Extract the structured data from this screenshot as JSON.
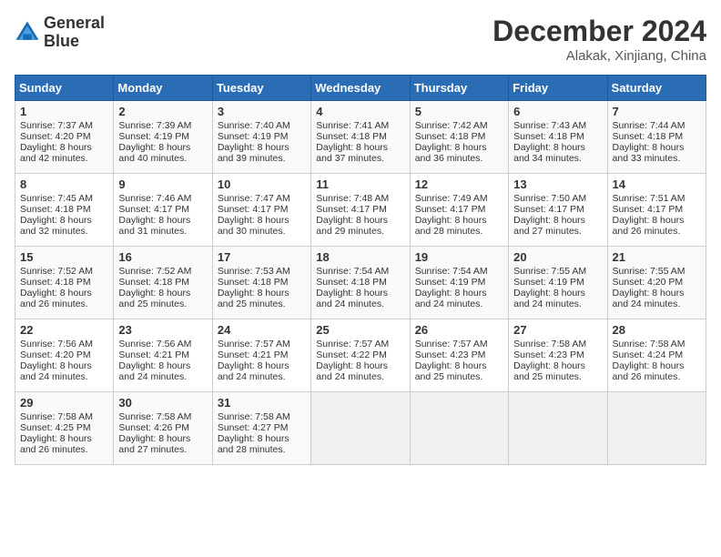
{
  "header": {
    "logo_line1": "General",
    "logo_line2": "Blue",
    "month_year": "December 2024",
    "location": "Alakak, Xinjiang, China"
  },
  "weekdays": [
    "Sunday",
    "Monday",
    "Tuesday",
    "Wednesday",
    "Thursday",
    "Friday",
    "Saturday"
  ],
  "weeks": [
    [
      {
        "day": "1",
        "sunrise": "Sunrise: 7:37 AM",
        "sunset": "Sunset: 4:20 PM",
        "daylight": "Daylight: 8 hours and 42 minutes."
      },
      {
        "day": "2",
        "sunrise": "Sunrise: 7:39 AM",
        "sunset": "Sunset: 4:19 PM",
        "daylight": "Daylight: 8 hours and 40 minutes."
      },
      {
        "day": "3",
        "sunrise": "Sunrise: 7:40 AM",
        "sunset": "Sunset: 4:19 PM",
        "daylight": "Daylight: 8 hours and 39 minutes."
      },
      {
        "day": "4",
        "sunrise": "Sunrise: 7:41 AM",
        "sunset": "Sunset: 4:18 PM",
        "daylight": "Daylight: 8 hours and 37 minutes."
      },
      {
        "day": "5",
        "sunrise": "Sunrise: 7:42 AM",
        "sunset": "Sunset: 4:18 PM",
        "daylight": "Daylight: 8 hours and 36 minutes."
      },
      {
        "day": "6",
        "sunrise": "Sunrise: 7:43 AM",
        "sunset": "Sunset: 4:18 PM",
        "daylight": "Daylight: 8 hours and 34 minutes."
      },
      {
        "day": "7",
        "sunrise": "Sunrise: 7:44 AM",
        "sunset": "Sunset: 4:18 PM",
        "daylight": "Daylight: 8 hours and 33 minutes."
      }
    ],
    [
      {
        "day": "8",
        "sunrise": "Sunrise: 7:45 AM",
        "sunset": "Sunset: 4:18 PM",
        "daylight": "Daylight: 8 hours and 32 minutes."
      },
      {
        "day": "9",
        "sunrise": "Sunrise: 7:46 AM",
        "sunset": "Sunset: 4:17 PM",
        "daylight": "Daylight: 8 hours and 31 minutes."
      },
      {
        "day": "10",
        "sunrise": "Sunrise: 7:47 AM",
        "sunset": "Sunset: 4:17 PM",
        "daylight": "Daylight: 8 hours and 30 minutes."
      },
      {
        "day": "11",
        "sunrise": "Sunrise: 7:48 AM",
        "sunset": "Sunset: 4:17 PM",
        "daylight": "Daylight: 8 hours and 29 minutes."
      },
      {
        "day": "12",
        "sunrise": "Sunrise: 7:49 AM",
        "sunset": "Sunset: 4:17 PM",
        "daylight": "Daylight: 8 hours and 28 minutes."
      },
      {
        "day": "13",
        "sunrise": "Sunrise: 7:50 AM",
        "sunset": "Sunset: 4:17 PM",
        "daylight": "Daylight: 8 hours and 27 minutes."
      },
      {
        "day": "14",
        "sunrise": "Sunrise: 7:51 AM",
        "sunset": "Sunset: 4:17 PM",
        "daylight": "Daylight: 8 hours and 26 minutes."
      }
    ],
    [
      {
        "day": "15",
        "sunrise": "Sunrise: 7:52 AM",
        "sunset": "Sunset: 4:18 PM",
        "daylight": "Daylight: 8 hours and 26 minutes."
      },
      {
        "day": "16",
        "sunrise": "Sunrise: 7:52 AM",
        "sunset": "Sunset: 4:18 PM",
        "daylight": "Daylight: 8 hours and 25 minutes."
      },
      {
        "day": "17",
        "sunrise": "Sunrise: 7:53 AM",
        "sunset": "Sunset: 4:18 PM",
        "daylight": "Daylight: 8 hours and 25 minutes."
      },
      {
        "day": "18",
        "sunrise": "Sunrise: 7:54 AM",
        "sunset": "Sunset: 4:18 PM",
        "daylight": "Daylight: 8 hours and 24 minutes."
      },
      {
        "day": "19",
        "sunrise": "Sunrise: 7:54 AM",
        "sunset": "Sunset: 4:19 PM",
        "daylight": "Daylight: 8 hours and 24 minutes."
      },
      {
        "day": "20",
        "sunrise": "Sunrise: 7:55 AM",
        "sunset": "Sunset: 4:19 PM",
        "daylight": "Daylight: 8 hours and 24 minutes."
      },
      {
        "day": "21",
        "sunrise": "Sunrise: 7:55 AM",
        "sunset": "Sunset: 4:20 PM",
        "daylight": "Daylight: 8 hours and 24 minutes."
      }
    ],
    [
      {
        "day": "22",
        "sunrise": "Sunrise: 7:56 AM",
        "sunset": "Sunset: 4:20 PM",
        "daylight": "Daylight: 8 hours and 24 minutes."
      },
      {
        "day": "23",
        "sunrise": "Sunrise: 7:56 AM",
        "sunset": "Sunset: 4:21 PM",
        "daylight": "Daylight: 8 hours and 24 minutes."
      },
      {
        "day": "24",
        "sunrise": "Sunrise: 7:57 AM",
        "sunset": "Sunset: 4:21 PM",
        "daylight": "Daylight: 8 hours and 24 minutes."
      },
      {
        "day": "25",
        "sunrise": "Sunrise: 7:57 AM",
        "sunset": "Sunset: 4:22 PM",
        "daylight": "Daylight: 8 hours and 24 minutes."
      },
      {
        "day": "26",
        "sunrise": "Sunrise: 7:57 AM",
        "sunset": "Sunset: 4:23 PM",
        "daylight": "Daylight: 8 hours and 25 minutes."
      },
      {
        "day": "27",
        "sunrise": "Sunrise: 7:58 AM",
        "sunset": "Sunset: 4:23 PM",
        "daylight": "Daylight: 8 hours and 25 minutes."
      },
      {
        "day": "28",
        "sunrise": "Sunrise: 7:58 AM",
        "sunset": "Sunset: 4:24 PM",
        "daylight": "Daylight: 8 hours and 26 minutes."
      }
    ],
    [
      {
        "day": "29",
        "sunrise": "Sunrise: 7:58 AM",
        "sunset": "Sunset: 4:25 PM",
        "daylight": "Daylight: 8 hours and 26 minutes."
      },
      {
        "day": "30",
        "sunrise": "Sunrise: 7:58 AM",
        "sunset": "Sunset: 4:26 PM",
        "daylight": "Daylight: 8 hours and 27 minutes."
      },
      {
        "day": "31",
        "sunrise": "Sunrise: 7:58 AM",
        "sunset": "Sunset: 4:27 PM",
        "daylight": "Daylight: 8 hours and 28 minutes."
      },
      null,
      null,
      null,
      null
    ]
  ]
}
